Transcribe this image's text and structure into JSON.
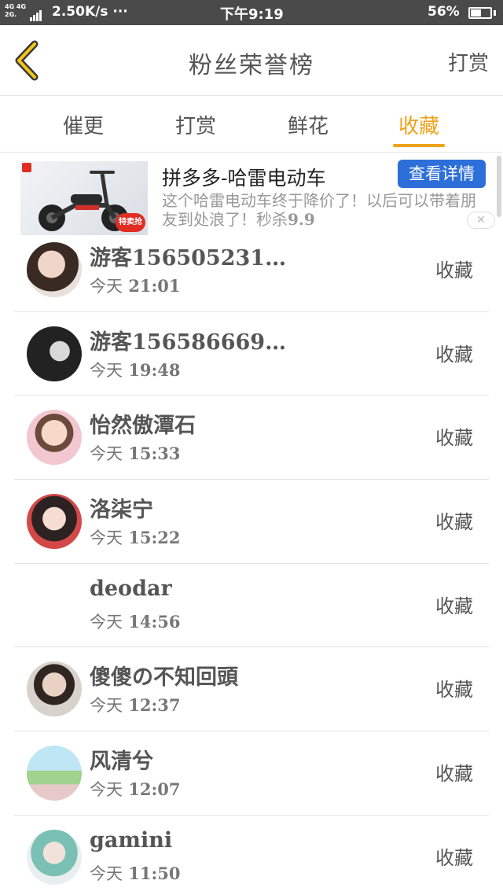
{
  "status_bar": {
    "signal_top": "4G 4G",
    "signal_bottom": "2G.",
    "speed": "2.50K/s ···",
    "time": "下午9:19",
    "battery_percent": "56%",
    "battery_level": 0.56
  },
  "header": {
    "title": "粉丝荣誉榜",
    "right_link": "打赏",
    "back_icon": "chevron-left-icon"
  },
  "tabs": [
    {
      "label": "催更",
      "active": false
    },
    {
      "label": "打赏",
      "active": false
    },
    {
      "label": "鲜花",
      "active": false
    },
    {
      "label": "收藏",
      "active": true
    }
  ],
  "accent_color": "#f0a21b",
  "ad": {
    "title": "拼多多-哈雷电动车",
    "button": "查看详情",
    "description": "这个哈雷电动车终于降价了！以后可以带着朋友到处浪了！秒杀",
    "price": "9.9",
    "sticker": "特卖抢",
    "close_icon": "close-icon"
  },
  "list": [
    {
      "name": "游客156505231…",
      "time_prefix": "今天",
      "time": "21:01",
      "action": "收藏",
      "avatar": true
    },
    {
      "name": "游客156586669…",
      "time_prefix": "今天",
      "time": "19:48",
      "action": "收藏",
      "avatar": true
    },
    {
      "name": "怡然傲潭石",
      "time_prefix": "今天",
      "time": "15:33",
      "action": "收藏",
      "avatar": true
    },
    {
      "name": "洛柒宁",
      "time_prefix": "今天",
      "time": "15:22",
      "action": "收藏",
      "avatar": true
    },
    {
      "name": "deodar",
      "time_prefix": "今天",
      "time": "14:56",
      "action": "收藏",
      "avatar": false
    },
    {
      "name": "傻傻の不知回頭",
      "time_prefix": "今天",
      "time": "12:37",
      "action": "收藏",
      "avatar": true
    },
    {
      "name": "风清兮",
      "time_prefix": "今天",
      "time": "12:07",
      "action": "收藏",
      "avatar": true
    },
    {
      "name": "gamini",
      "time_prefix": "今天",
      "time": "11:50",
      "action": "收藏",
      "avatar": true
    }
  ]
}
